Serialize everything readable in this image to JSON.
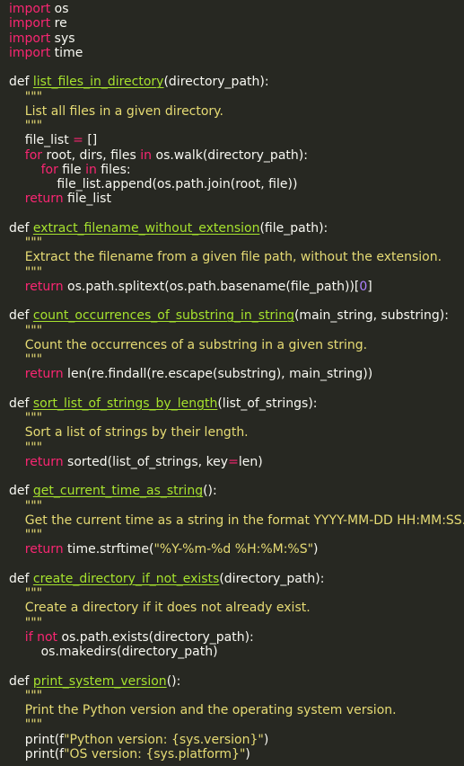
{
  "editor": {
    "colors": {
      "background": "#272822",
      "keyword": "#f92672",
      "function_name": "#a6e22e",
      "string": "#e6db74",
      "number": "#ae81ff",
      "text": "#f8f8f2"
    },
    "lines": [
      [
        [
          "kw",
          "import"
        ],
        [
          "txt",
          " os"
        ]
      ],
      [
        [
          "kw",
          "import"
        ],
        [
          "txt",
          " re"
        ]
      ],
      [
        [
          "kw",
          "import"
        ],
        [
          "txt",
          " sys"
        ]
      ],
      [
        [
          "kw",
          "import"
        ],
        [
          "txt",
          " time"
        ]
      ],
      [],
      [
        [
          "txt",
          "def "
        ],
        [
          "fn",
          "list_files_in_directory"
        ],
        [
          "txt",
          "(directory_path):"
        ]
      ],
      [
        [
          "doc",
          "    \"\"\""
        ]
      ],
      [
        [
          "doc",
          "    List all files in a given directory."
        ]
      ],
      [
        [
          "doc",
          "    \"\"\""
        ]
      ],
      [
        [
          "txt",
          "    file_list "
        ],
        [
          "kw",
          "="
        ],
        [
          "txt",
          " []"
        ]
      ],
      [
        [
          "kw",
          "    for"
        ],
        [
          "txt",
          " root, dirs, files "
        ],
        [
          "kw",
          "in"
        ],
        [
          "txt",
          " os.walk(directory_path):"
        ]
      ],
      [
        [
          "kw",
          "        for"
        ],
        [
          "txt",
          " file "
        ],
        [
          "kw",
          "in"
        ],
        [
          "txt",
          " files:"
        ]
      ],
      [
        [
          "txt",
          "            file_list.append(os.path.join(root, file))"
        ]
      ],
      [
        [
          "kw",
          "    return"
        ],
        [
          "txt",
          " file_list"
        ]
      ],
      [],
      [
        [
          "txt",
          "def "
        ],
        [
          "fn",
          "extract_filename_without_extension"
        ],
        [
          "txt",
          "(file_path):"
        ]
      ],
      [
        [
          "doc",
          "    \"\"\""
        ]
      ],
      [
        [
          "doc",
          "    Extract the filename from a given file path, without the extension."
        ]
      ],
      [
        [
          "doc",
          "    \"\"\""
        ]
      ],
      [
        [
          "kw",
          "    return"
        ],
        [
          "txt",
          " os.path.splitext(os.path.basename(file_path))["
        ],
        [
          "num",
          "0"
        ],
        [
          "txt",
          "]"
        ]
      ],
      [],
      [
        [
          "txt",
          "def "
        ],
        [
          "fn",
          "count_occurrences_of_substring_in_string"
        ],
        [
          "txt",
          "(main_string, substring):"
        ]
      ],
      [
        [
          "doc",
          "    \"\"\""
        ]
      ],
      [
        [
          "doc",
          "    Count the occurrences of a substring in a given string."
        ]
      ],
      [
        [
          "doc",
          "    \"\"\""
        ]
      ],
      [
        [
          "kw",
          "    return"
        ],
        [
          "txt",
          " len(re.findall(re.escape(substring), main_string))"
        ]
      ],
      [],
      [
        [
          "txt",
          "def "
        ],
        [
          "fn",
          "sort_list_of_strings_by_length"
        ],
        [
          "txt",
          "(list_of_strings):"
        ]
      ],
      [
        [
          "doc",
          "    \"\"\""
        ]
      ],
      [
        [
          "doc",
          "    Sort a list of strings by their length."
        ]
      ],
      [
        [
          "doc",
          "    \"\"\""
        ]
      ],
      [
        [
          "kw",
          "    return"
        ],
        [
          "txt",
          " sorted(list_of_strings, key"
        ],
        [
          "kw",
          "="
        ],
        [
          "txt",
          "len)"
        ]
      ],
      [],
      [
        [
          "txt",
          "def "
        ],
        [
          "fn",
          "get_current_time_as_string"
        ],
        [
          "txt",
          "():"
        ]
      ],
      [
        [
          "doc",
          "    \"\"\""
        ]
      ],
      [
        [
          "doc",
          "    Get the current time as a string in the format YYYY-MM-DD HH:MM:SS."
        ]
      ],
      [
        [
          "doc",
          "    \"\"\""
        ]
      ],
      [
        [
          "kw",
          "    return"
        ],
        [
          "txt",
          " time.strftime("
        ],
        [
          "str",
          "\"%Y-%m-%d %H:%M:%S\""
        ],
        [
          "txt",
          ")"
        ]
      ],
      [],
      [
        [
          "txt",
          "def "
        ],
        [
          "fn",
          "create_directory_if_not_exists"
        ],
        [
          "txt",
          "(directory_path):"
        ]
      ],
      [
        [
          "doc",
          "    \"\"\""
        ]
      ],
      [
        [
          "doc",
          "    Create a directory if it does not already exist."
        ]
      ],
      [
        [
          "doc",
          "    \"\"\""
        ]
      ],
      [
        [
          "kw",
          "    if not"
        ],
        [
          "txt",
          " os.path.exists(directory_path):"
        ]
      ],
      [
        [
          "txt",
          "        os.makedirs(directory_path)"
        ]
      ],
      [],
      [
        [
          "txt",
          "def "
        ],
        [
          "fn",
          "print_system_version"
        ],
        [
          "txt",
          "():"
        ]
      ],
      [
        [
          "doc",
          "    \"\"\""
        ]
      ],
      [
        [
          "doc",
          "    Print the Python version and the operating system version."
        ]
      ],
      [
        [
          "doc",
          "    \"\"\""
        ]
      ],
      [
        [
          "txt",
          "    print(f"
        ],
        [
          "str",
          "\"Python version: {sys.version}\""
        ],
        [
          "txt",
          ")"
        ]
      ],
      [
        [
          "txt",
          "    print(f"
        ],
        [
          "str",
          "\"OS version: {sys.platform}\""
        ],
        [
          "txt",
          ")"
        ]
      ]
    ]
  }
}
